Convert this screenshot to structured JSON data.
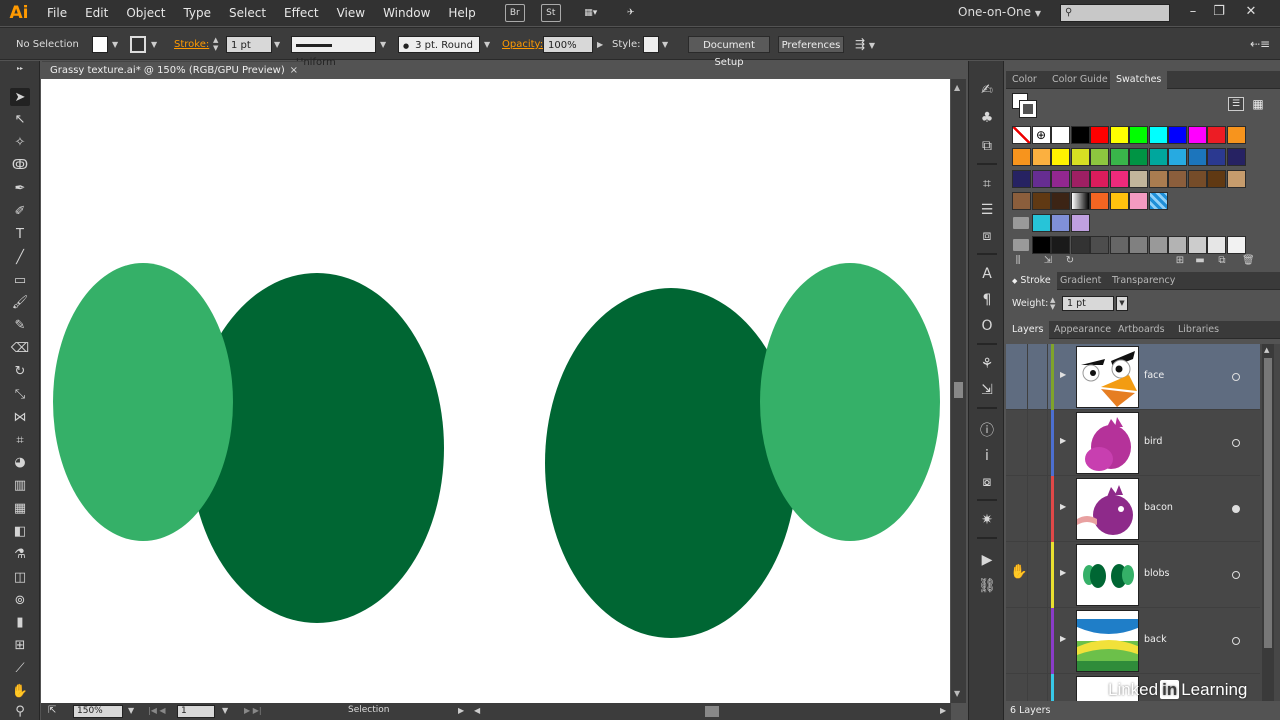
{
  "app": {
    "logo": "Ai",
    "menu": [
      "File",
      "Edit",
      "Object",
      "Type",
      "Select",
      "Effect",
      "View",
      "Window",
      "Help"
    ],
    "bridge": "Br",
    "stock": "St",
    "workspace": "One-on-One"
  },
  "controlbar": {
    "selection": "No Selection",
    "stroke_label": "Stroke:",
    "stroke_weight": "1 pt",
    "stroke_profile": "Uniform",
    "brush": "3 pt. Round",
    "opacity_label": "Opacity:",
    "opacity": "100%",
    "style_label": "Style:",
    "document_setup": "Document Setup",
    "preferences": "Preferences"
  },
  "document": {
    "tab_title": "Grassy texture.ai* @ 150% (RGB/GPU Preview)",
    "close": "×"
  },
  "statusbar": {
    "zoom": "150%",
    "artboard": "1",
    "tool": "Selection"
  },
  "swatches_panel": {
    "tabs": [
      "Color",
      "Color Guide",
      "Swatches"
    ],
    "active_tab": "Swatches"
  },
  "stroke_panel": {
    "tabs": [
      "Stroke",
      "Gradient",
      "Transparency"
    ],
    "weight_label": "Weight:",
    "weight": "1 pt"
  },
  "layers_panel": {
    "tabs": [
      "Layers",
      "Appearance",
      "Artboards",
      "Libraries"
    ],
    "layers": [
      {
        "name": "face",
        "color": "#7fa32b",
        "selected": true,
        "target_filled": false
      },
      {
        "name": "bird",
        "color": "#4c6fd0",
        "selected": false,
        "target_filled": false
      },
      {
        "name": "bacon",
        "color": "#e04848",
        "selected": false,
        "target_filled": true
      },
      {
        "name": "blobs",
        "color": "#e8e030",
        "selected": false,
        "target_filled": false
      },
      {
        "name": "back",
        "color": "#8a3cc8",
        "selected": false,
        "target_filled": false
      }
    ],
    "count": "6 Layers"
  },
  "artwork": {
    "light_green": "#35b068",
    "dark_green": "#006633"
  },
  "watermark": {
    "brand_left": "Linked",
    "brand_in": "in",
    "brand_right": "Learning"
  }
}
